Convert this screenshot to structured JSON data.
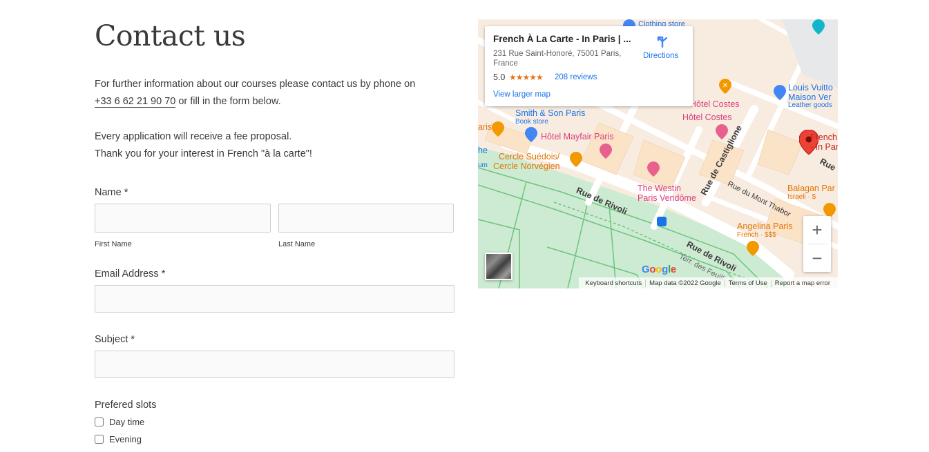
{
  "page": {
    "title": "Contact us",
    "intro_line1": "For further information about our courses please contact us by phone on",
    "phone": "+33 6 62 21 90 70",
    "intro_line2_suffix": " or fill in the form below.",
    "fee_text": "Every application will receive a fee proposal.",
    "thanks_text": "Thank you for your interest in French \"à la carte\"!"
  },
  "form": {
    "name_label": "Name *",
    "first_name_label": "First Name",
    "last_name_label": "Last Name",
    "email_label": "Email Address *",
    "subject_label": "Subject *",
    "slots_label": "Prefered slots",
    "slot_options": [
      "Day time",
      "Evening"
    ]
  },
  "map": {
    "info": {
      "title": "French À La Carte - In Paris | ...",
      "address": "231 Rue Saint-Honoré, 75001 Paris, France",
      "rating": "5.0",
      "stars": "★★★★★",
      "reviews": "208 reviews",
      "view_larger": "View larger map",
      "directions": "Directions"
    },
    "pois": {
      "clothing_store": "Clothing store",
      "louis_vuitton": "Louis Vuitto",
      "maison_ver": "Maison Ver",
      "leather_goods": "Leather goods",
      "hotel_costes_1": "Hôtel Costes",
      "hotel_costes_2": "Hôtel Costes",
      "smith_son": "Smith & Son Paris",
      "book_store": "Book store",
      "hotel_mayfair": "Hôtel Mayfair Paris",
      "cercle_1": "Cercle Suédois/",
      "cercle_2": "Cercle Norvégien",
      "westin_1": "The Westin",
      "westin_2": "Paris Vendôme",
      "french_pin_1": "French",
      "french_pin_2": "- In Par",
      "balagan": "Balagan Par",
      "israeli": "Israeli · $",
      "angelina": "Angelina Paris",
      "french_price": "French · $$$",
      "left_paris": "aris",
      "left_he": "he",
      "left_um": "um"
    },
    "streets": {
      "rue_de_rivoli_1": "Rue de Rivoli",
      "rue_de_rivoli_2": "Rue de Rivoli",
      "rue_de_castiglione": "Rue de Castiglione",
      "rue_du_mont_thabor": "Rue du Mont Thabor",
      "terr_des_feuill": "Terr. des Feuill",
      "rue_right": "Rue"
    },
    "google_logo": "Google",
    "footer": [
      "Keyboard shortcuts",
      "Map data ©2022 Google",
      "Terms of Use",
      "Report a map error"
    ],
    "zoom_in": "+",
    "zoom_out": "−",
    "colors": {
      "park": "#cdebd2",
      "block": "#f9ecd9",
      "road": "#ffffff",
      "poi_orange": "#e37400",
      "poi_pink": "#d93e7b",
      "poi_blue": "#1a73e8",
      "pin_red": "#ea4335"
    }
  }
}
